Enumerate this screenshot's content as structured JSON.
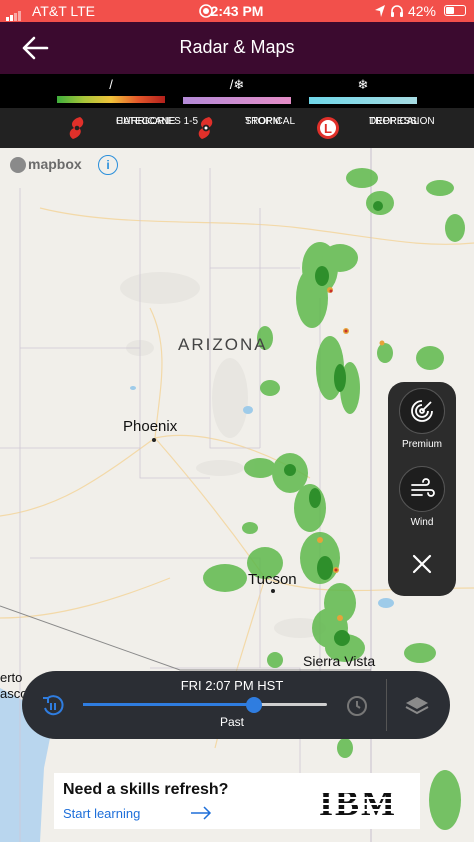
{
  "status": {
    "carrier": "AT&T  LTE",
    "time": "2:43 PM",
    "battery": "42%"
  },
  "header": {
    "title": "Radar & Maps"
  },
  "legend": {
    "precip": [
      {
        "symbol": "/",
        "colors": [
          "#46b840",
          "#b0c63c",
          "#f0c23a",
          "#e44a2a",
          "#b2201c"
        ]
      },
      {
        "symbol": "/❄",
        "colors": [
          "#b78ad6",
          "#e28ac9"
        ]
      },
      {
        "symbol": "❄",
        "colors": [
          "#6fd7e6",
          "#9fd8e2"
        ]
      }
    ],
    "storms": [
      {
        "line1": "HURRICANE",
        "line2": "CATEGORIES 1-5"
      },
      {
        "line1": "TROPICAL",
        "line2": "STORM"
      },
      {
        "line1": "TROPICAL",
        "line2": "DEPRESSION"
      }
    ]
  },
  "map": {
    "attribution": "mapbox",
    "info": "i",
    "state_label": "ARIZONA",
    "cities": {
      "phoenix": "Phoenix",
      "tucson": "Tucson",
      "sierra_vista": "Sierra Vista",
      "puerto_a": "erto",
      "puerto_b": "asco"
    }
  },
  "panel": {
    "premium_label": "Premium",
    "wind_label": "Wind"
  },
  "timeline": {
    "time_label": "FRI 2:07 PM HST",
    "state_label": "Past",
    "progress": 0.7
  },
  "ad": {
    "headline": "Need a skills refresh?",
    "cta": "Start learning",
    "brand": "IBM"
  }
}
